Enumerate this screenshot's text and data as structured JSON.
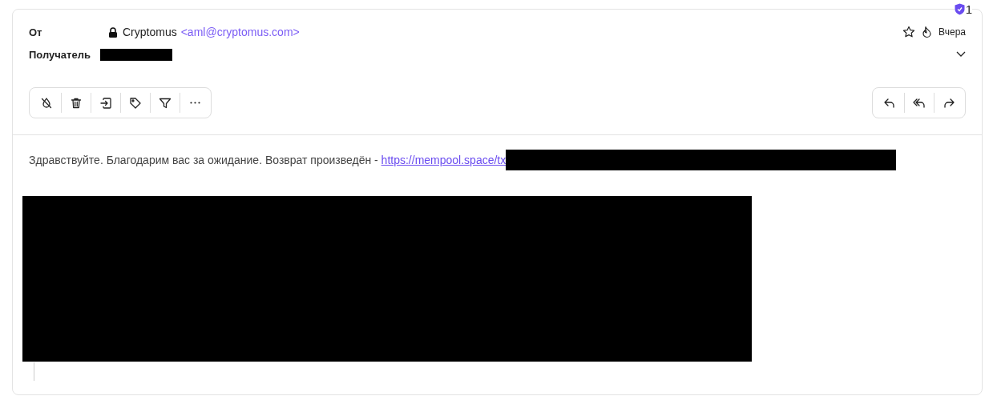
{
  "badge": {
    "count": "1"
  },
  "header": {
    "from_label": "От",
    "sender_name": "Cryptomus",
    "sender_email": "<aml@cryptomus.com>",
    "recipient_label": "Получатель",
    "date": "Вчера",
    "starred": false
  },
  "body": {
    "text": "Здравствуйте. Благодарим вас за ожидание. Возврат произведён - ",
    "link": "https://mempool.space/tx"
  }
}
